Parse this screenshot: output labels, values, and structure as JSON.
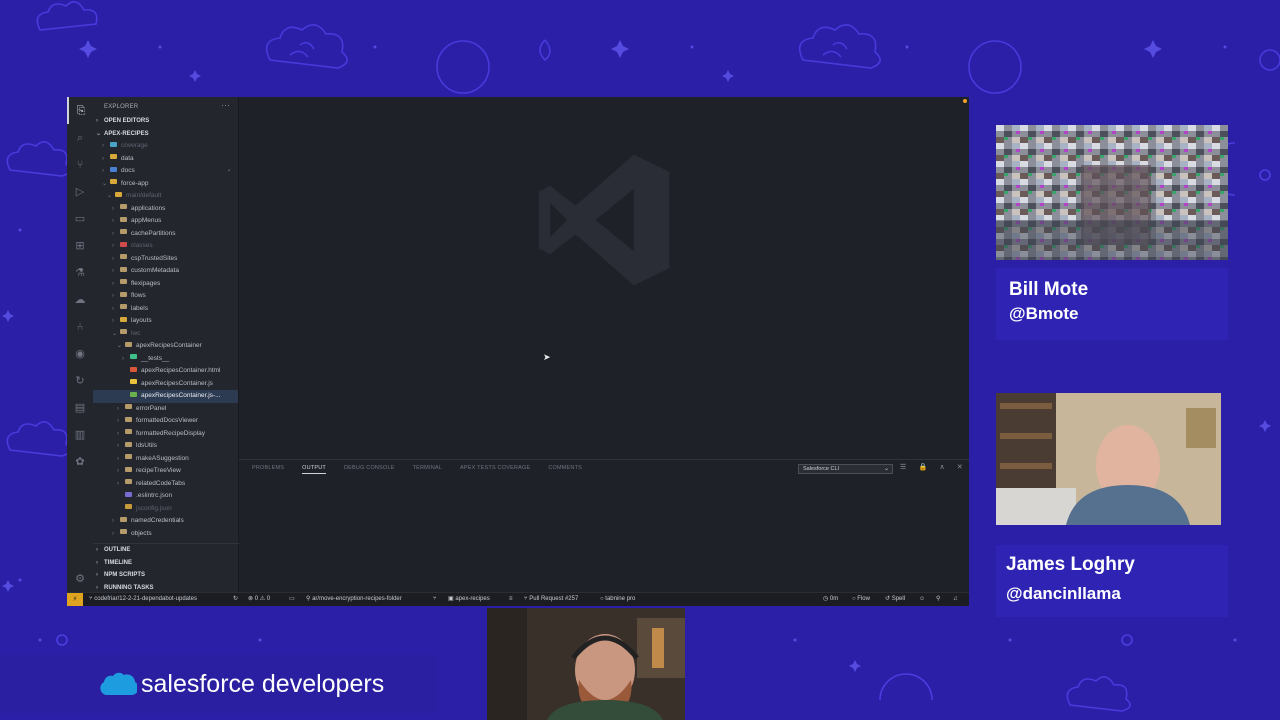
{
  "explorer": {
    "title": "EXPLORER",
    "more": "···",
    "open_editors": "OPEN EDITORS",
    "project": "APEX-RECIPES",
    "tree": [
      {
        "label": "coverage",
        "depth": 1,
        "twisty": ">",
        "color": "#4aa3c7",
        "dim": true
      },
      {
        "label": "data",
        "depth": 1,
        "twisty": ">",
        "color": "#d6a93a"
      },
      {
        "label": "docs",
        "depth": 1,
        "twisty": ">",
        "color": "#4a7fd1",
        "badge": "•"
      },
      {
        "label": "force-app",
        "depth": 1,
        "twisty": "∨",
        "color": "#d6a93a"
      },
      {
        "label": "main/default",
        "depth": 2,
        "twisty": "∨",
        "color": "#d6a93a",
        "dim": true
      },
      {
        "label": "applications",
        "depth": 3,
        "twisty": ">",
        "color": "#b59a6a"
      },
      {
        "label": "appMenus",
        "depth": 3,
        "twisty": ">",
        "color": "#b59a6a"
      },
      {
        "label": "cachePartitions",
        "depth": 3,
        "twisty": ">",
        "color": "#b59a6a"
      },
      {
        "label": "classes",
        "depth": 3,
        "twisty": ">",
        "color": "#d14b4b",
        "dim": true
      },
      {
        "label": "cspTrustedSites",
        "depth": 3,
        "twisty": ">",
        "color": "#b59a6a"
      },
      {
        "label": "customMetadata",
        "depth": 3,
        "twisty": ">",
        "color": "#b59a6a"
      },
      {
        "label": "flexipages",
        "depth": 3,
        "twisty": ">",
        "color": "#b59a6a"
      },
      {
        "label": "flows",
        "depth": 3,
        "twisty": ">",
        "color": "#b59a6a"
      },
      {
        "label": "labels",
        "depth": 3,
        "twisty": ">",
        "color": "#b59a6a"
      },
      {
        "label": "layouts",
        "depth": 3,
        "twisty": ">",
        "color": "#d6a93a"
      },
      {
        "label": "lwc",
        "depth": 3,
        "twisty": "∨",
        "color": "#b59a6a",
        "dim": true
      },
      {
        "label": "apexRecipesContainer",
        "depth": 4,
        "twisty": "∨",
        "color": "#b59a6a"
      },
      {
        "label": "__tests__",
        "depth": 5,
        "twisty": ">",
        "color": "#3fbf8a"
      },
      {
        "label": "apexRecipesContainer.html",
        "depth": 5,
        "twisty": "",
        "color": "#d9583b"
      },
      {
        "label": "apexRecipesContainer.js",
        "depth": 5,
        "twisty": "",
        "color": "#e8c23a"
      },
      {
        "label": "apexRecipesContainer.js-...",
        "depth": 5,
        "twisty": "",
        "color": "#6ab04c",
        "selected": true
      },
      {
        "label": "errorPanel",
        "depth": 4,
        "twisty": ">",
        "color": "#b59a6a"
      },
      {
        "label": "formattedDocsViewer",
        "depth": 4,
        "twisty": ">",
        "color": "#b59a6a"
      },
      {
        "label": "formattedRecipeDisplay",
        "depth": 4,
        "twisty": ">",
        "color": "#b59a6a"
      },
      {
        "label": "ldsUtils",
        "depth": 4,
        "twisty": ">",
        "color": "#b59a6a"
      },
      {
        "label": "makeASuggestion",
        "depth": 4,
        "twisty": ">",
        "color": "#b59a6a"
      },
      {
        "label": "recipeTreeView",
        "depth": 4,
        "twisty": ">",
        "color": "#b59a6a"
      },
      {
        "label": "relatedCodeTabs",
        "depth": 4,
        "twisty": ">",
        "color": "#b59a6a"
      },
      {
        "label": ".eslintrc.json",
        "depth": 4,
        "twisty": "",
        "color": "#7a6ad1"
      },
      {
        "label": "jsconfig.json",
        "depth": 4,
        "twisty": "",
        "color": "#c69a3a",
        "dim": true
      },
      {
        "label": "namedCredentials",
        "depth": 3,
        "twisty": ">",
        "color": "#b59a6a"
      },
      {
        "label": "objects",
        "depth": 3,
        "twisty": ">",
        "color": "#b59a6a"
      }
    ],
    "bottom_sections": [
      "OUTLINE",
      "TIMELINE",
      "NPM SCRIPTS",
      "RUNNING TASKS"
    ]
  },
  "activity_icons": [
    "files-icon",
    "search-icon",
    "source-control-icon",
    "run-debug-icon",
    "remote-explorer-icon",
    "extensions-icon",
    "testing-icon",
    "salesforce-icon",
    "git-graph-icon",
    "github-icon",
    "sync-icon",
    "settings-gear-icon",
    "folder-icon",
    "book-icon",
    "paw-icon"
  ],
  "panel": {
    "tabs": [
      "PROBLEMS",
      "OUTPUT",
      "DEBUG CONSOLE",
      "TERMINAL",
      "APEX TESTS COVERAGE",
      "COMMENTS"
    ],
    "active_tab": "OUTPUT",
    "output_channel": "Salesforce CLI",
    "icons": "☰ 🔒 ∧ ✕"
  },
  "statusbar": {
    "branch": "codefriar/12-2-21-dependabot-updates",
    "problems": "⊗ 0 ⚠ 0",
    "pr_branch": "ar/move-encryption-recipes-folder",
    "project": "apex-recipes",
    "pull_request": "Pull Request #257",
    "tabnine": "tabnine pro",
    "time": "0m",
    "flow": "Flow",
    "spell": "Spell"
  },
  "participants": [
    {
      "name": "Bill Mote",
      "handle": "@Bmote"
    },
    {
      "name": "James Loghry",
      "handle": "@dancinllama"
    }
  ],
  "brand": {
    "text": "salesforce developers"
  },
  "colors": {
    "background": "#2b1fa8",
    "name_box": "#2f23b4",
    "editor_bg": "#1e2128",
    "accent": "#e0a320"
  }
}
